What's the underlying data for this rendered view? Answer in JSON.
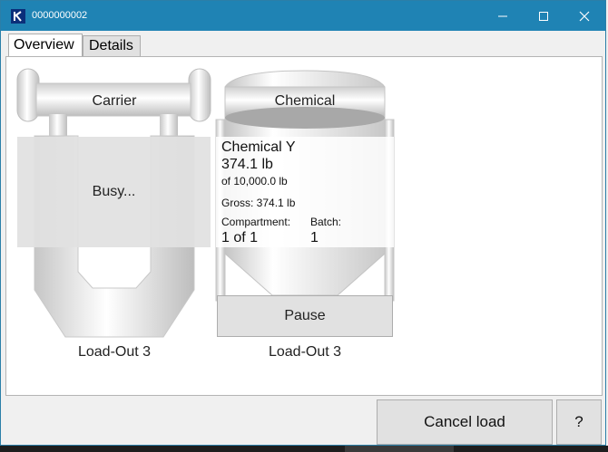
{
  "window": {
    "title": "0000000002"
  },
  "tabs": [
    {
      "label": "Overview"
    },
    {
      "label": "Details"
    }
  ],
  "carrier": {
    "label": "Carrier",
    "status": "Busy...",
    "caption": "Load-Out 3"
  },
  "chemical": {
    "label": "Chemical",
    "name": "Chemical Y",
    "weight": "374.1 lb",
    "capacity": "of 10,000.0 lb",
    "gross": "Gross: 374.1 lb",
    "compartment_label": "Compartment:",
    "compartment_value": "1 of 1",
    "batch_label": "Batch:",
    "batch_value": "1",
    "pause_label": "Pause",
    "caption": "Load-Out 3"
  },
  "footer": {
    "cancel_label": "Cancel load",
    "help_label": "?"
  }
}
